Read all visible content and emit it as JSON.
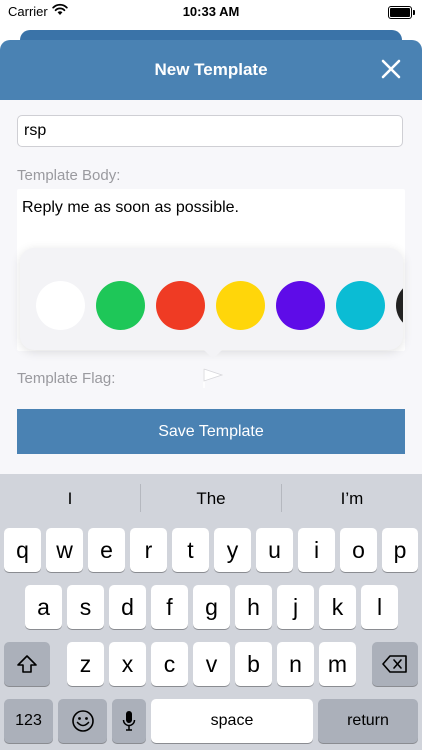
{
  "status_bar": {
    "carrier": "Carrier",
    "time": "10:33 AM"
  },
  "nav": {
    "title": "New Template"
  },
  "form": {
    "name_value": "rsp",
    "body_label": "Template Body:",
    "body_text": "Reply me as soon as possible.",
    "flag_label": "Template Flag:",
    "save_label": "Save Template"
  },
  "flag_colors": [
    "#ffffff",
    "#1ec758",
    "#ef3b24",
    "#ffd60a",
    "#5e0ce8",
    "#0bbcd4",
    "#222222"
  ],
  "keyboard": {
    "suggestions": [
      "I",
      "The",
      "I’m"
    ],
    "row1": [
      "q",
      "w",
      "e",
      "r",
      "t",
      "y",
      "u",
      "i",
      "o",
      "p"
    ],
    "row2": [
      "a",
      "s",
      "d",
      "f",
      "g",
      "h",
      "j",
      "k",
      "l"
    ],
    "row3": [
      "z",
      "x",
      "c",
      "v",
      "b",
      "n",
      "m"
    ],
    "numbers_label": "123",
    "space_label": "space",
    "return_label": "return"
  }
}
